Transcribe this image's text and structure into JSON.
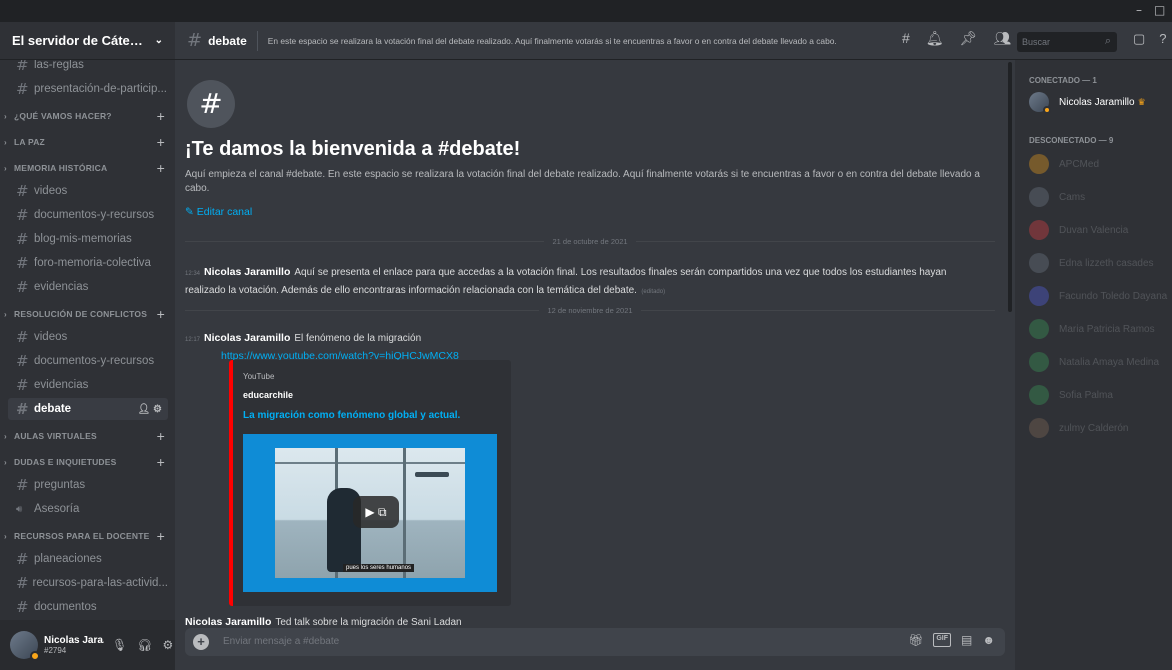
{
  "window": {
    "minimize": "–",
    "maximize": "□"
  },
  "server": {
    "name": "El servidor de Cátedra d...",
    "chevron": "chevron-down-icon"
  },
  "sidebar": {
    "items": [
      {
        "type": "channel",
        "label": "las-reglas",
        "top": 0
      },
      {
        "type": "channel",
        "label": "presentación-de-particip..."
      },
      {
        "type": "category",
        "label": "¿QUÉ VAMOS HACER?"
      },
      {
        "type": "category",
        "label": "LA PAZ"
      },
      {
        "type": "category",
        "label": "MEMORIA HISTÓRICA"
      },
      {
        "type": "channel",
        "label": "videos"
      },
      {
        "type": "channel",
        "label": "documentos-y-recursos"
      },
      {
        "type": "channel",
        "label": "blog-mis-memorias"
      },
      {
        "type": "channel",
        "label": "foro-memoria-colectiva"
      },
      {
        "type": "channel",
        "label": "evidencias"
      },
      {
        "type": "category",
        "label": "RESOLUCIÓN DE CONFLICTOS"
      },
      {
        "type": "channel",
        "label": "videos"
      },
      {
        "type": "channel",
        "label": "documentos-y-recursos"
      },
      {
        "type": "channel",
        "label": "evidencias"
      },
      {
        "type": "channel",
        "label": "debate",
        "active": true
      },
      {
        "type": "category",
        "label": "AULAS VIRTUALES"
      },
      {
        "type": "category",
        "label": "DUDAS E INQUIETUDES"
      },
      {
        "type": "channel",
        "label": "preguntas"
      },
      {
        "type": "voice",
        "label": "Asesoría"
      },
      {
        "type": "category",
        "label": "RECURSOS PARA EL DOCENTE"
      },
      {
        "type": "channel",
        "label": "planeaciones"
      },
      {
        "type": "channel",
        "label": "recursos-para-las-activid..."
      },
      {
        "type": "channel",
        "label": "documentos"
      }
    ]
  },
  "user": {
    "name": "Nicolas Jara...",
    "tag": "#2794"
  },
  "topbar": {
    "channel": "debate",
    "topic": "En este espacio se realizara la votación final del debate realizado. Aquí finalmente votarás si te encuentras a favor o en contra del debate llevado a cabo.",
    "search_placeholder": "Buscar"
  },
  "main": {
    "welcome_title": "¡Te damos la bienvenida a #debate!",
    "welcome_desc": "Aquí empieza el canal #debate. En este espacio se realizara la votación final del debate realizado. Aquí finalmente votarás si te encuentras a favor o en contra del debate llevado a cabo.",
    "edit_channel": "Editar canal",
    "date1": "21 de octubre de 2021",
    "msg1": {
      "time": "12:34",
      "author": "Nicolas Jaramillo",
      "text": "Aquí se presenta el enlace para que accedas a la votación final. Los resultados finales serán compartidos una vez que todos los estudiantes hayan realizado la votación. Además de ello encontraras información relacionada con la temática del debate.",
      "edited": "(editado)"
    },
    "date2": "12 de noviembre de 2021",
    "msg2": {
      "time": "12:17",
      "author": "Nicolas Jaramillo",
      "text": "El fenómeno de la migración",
      "link": "https://www.youtube.com/watch?v=hiQHCJwMCX8"
    },
    "embed": {
      "provider": "YouTube",
      "author": "educarchile",
      "title": "La migración como fenómeno global y actual.",
      "caption": "pues los seres humanos"
    },
    "msg3": {
      "author": "Nicolas Jaramillo",
      "text": "Ted talk sobre la migración de Sani Ladan"
    },
    "input_placeholder": "Enviar mensaje a #debate"
  },
  "members": {
    "online_header": "CONECTADO — 1",
    "offline_header": "DESCONECTADO — 9",
    "online": [
      {
        "name": "Nicolas Jaramillo"
      }
    ],
    "offline": [
      {
        "name": "APCMed",
        "color": "#faa61a"
      },
      {
        "name": "Cams",
        "color": "#747f8d"
      },
      {
        "name": "Duvan Valencia",
        "color": "#ed4245"
      },
      {
        "name": "Edna lizzeth casades",
        "color": "#747f8d"
      },
      {
        "name": "Facundo Toledo Dayana",
        "color": "#5865f2"
      },
      {
        "name": "Maria Patricia Ramos",
        "color": "#3ba55d"
      },
      {
        "name": "Natalia Amaya Medina",
        "color": "#3ba55d"
      },
      {
        "name": "Sofia Palma",
        "color": "#3ba55d"
      },
      {
        "name": "zulmy Calderón",
        "color": "#8a6d5a"
      }
    ]
  }
}
